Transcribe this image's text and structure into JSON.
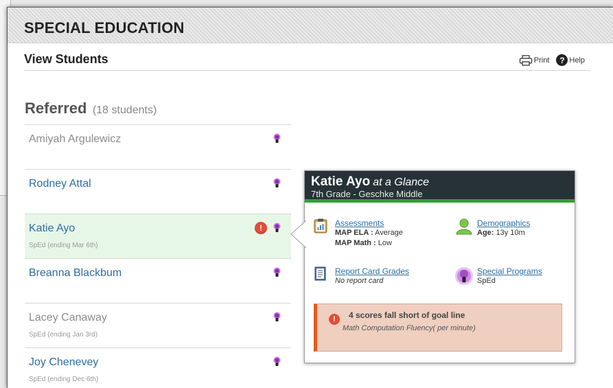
{
  "app": {
    "section_title": "SPECIAL EDUCATION"
  },
  "view": {
    "title": "View Students",
    "print_label": "Print",
    "help_label": "Help"
  },
  "referred": {
    "heading": "Referred",
    "count": "(18 students)"
  },
  "students": [
    {
      "name": "Amiyah Argulewicz",
      "sub": "",
      "muted": true,
      "alert": false
    },
    {
      "name": "Rodney Attal",
      "sub": "",
      "muted": false,
      "alert": false
    },
    {
      "name": "Katie Ayo",
      "sub": "SpEd (ending Mar 6th)",
      "muted": false,
      "alert": true
    },
    {
      "name": "Breanna Blackbum",
      "sub": "",
      "muted": false,
      "alert": false
    },
    {
      "name": "Lacey Canaway",
      "sub": "SpEd (ending Jan 3rd)",
      "muted": true,
      "alert": false
    },
    {
      "name": "Joy Chenevey",
      "sub": "SpEd (ending Dec 6th)",
      "muted": false,
      "alert": false
    }
  ],
  "glance": {
    "name": "Katie Ayo",
    "suffix": "at a Glance",
    "grade_school": "7th Grade - Geschke Middle",
    "assessments": {
      "label": "Assessments",
      "ela_label": "MAP ELA :",
      "ela_value": "Average",
      "math_label": "MAP Math :",
      "math_value": "Low"
    },
    "demographics": {
      "label": "Demographics",
      "age_label": "Age:",
      "age_value": "13y 10m"
    },
    "report_card": {
      "label": "Report Card Grades",
      "value": "No report card"
    },
    "special_programs": {
      "label": "Special Programs",
      "value": "SpEd"
    },
    "warning": {
      "icon": "!",
      "title": "4 scores fall short of goal line",
      "detail": "Math Computation Fluency( per minute)"
    }
  },
  "colors": {
    "link": "#2a6ea6",
    "header_dark": "#273238",
    "accent_green": "#2ea12e",
    "selected_row": "#e7f7e7",
    "alert_red": "#e44d3a",
    "warning_bg": "#efcfc0",
    "warning_bar": "#e45b1c",
    "bulb_purple": "#b44dcc"
  },
  "icons": {
    "print": "printer-icon",
    "help": "help-icon",
    "program": "lightbulb-icon",
    "alert": "alert-icon",
    "assessments": "clipboard-chart-icon",
    "demographics": "person-icon",
    "report_card": "report-card-icon",
    "special_programs": "special-programs-icon"
  }
}
